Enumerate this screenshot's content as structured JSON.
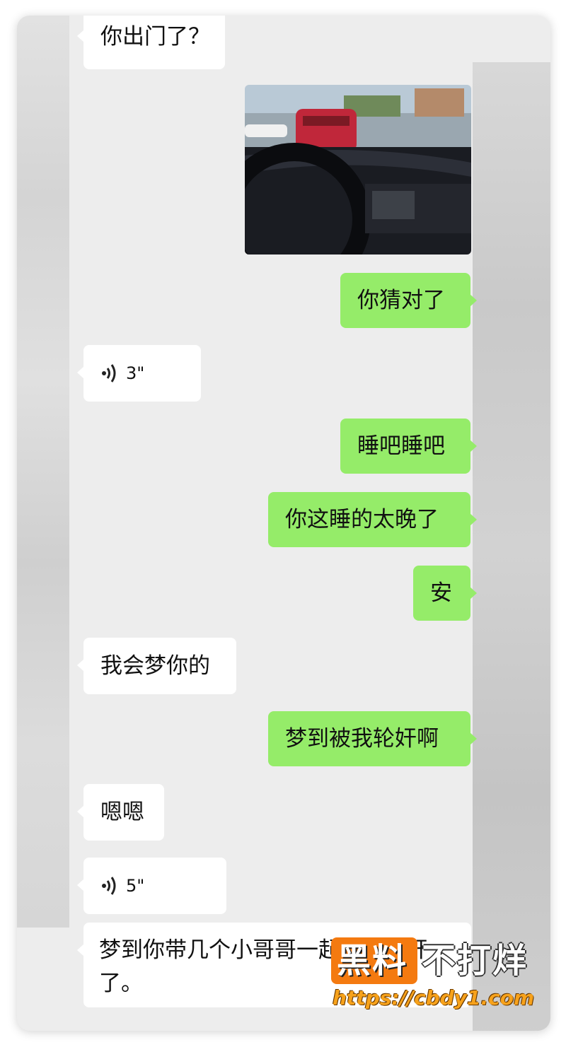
{
  "messages": {
    "m1": "你出门了？",
    "m2": "你猜对了",
    "m3_duration": "3\"",
    "m4": "睡吧睡吧",
    "m5": "你这睡的太晚了",
    "m6": "安",
    "m7": "我会梦你的",
    "m8": "梦到被我轮奸啊",
    "m9": "嗯嗯",
    "m10_duration": "5\"",
    "m11": "梦到你带几个小哥哥一起把我轮奸了。"
  },
  "watermark": {
    "brand_a": "黑料",
    "brand_b": "不打烊",
    "url": "https://cbdy1.com"
  },
  "colors": {
    "chat_background": "#ededed",
    "incoming_bubble": "#ffffff",
    "outgoing_bubble": "#95ec69",
    "watermark_orange": "#f47a10"
  },
  "icons": [
    "voice-wave-icon"
  ]
}
